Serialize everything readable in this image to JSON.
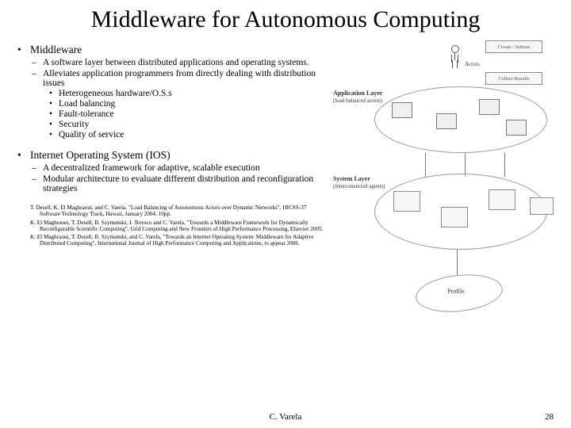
{
  "title": "Middleware for Autonomous Computing",
  "section1": {
    "heading": "Middleware",
    "items": [
      "A software layer between distributed applications and operating systems.",
      "Alleviates application programmers from directly dealing with distribution issues"
    ],
    "subitems": [
      "Heterogeneous hardware/O.S.s",
      "Load balancing",
      "Fault-tolerance",
      "Security",
      "Quality of service"
    ]
  },
  "section2": {
    "heading": "Internet Operating System (IOS)",
    "items": [
      "A decentralized framework for adaptive, scalable execution",
      "Modular architecture to evaluate different distribution and reconfiguration strategies"
    ]
  },
  "references": [
    "T. Desell, K. El Maghraoui, and C. Varela, \"Load Balancing of Autonomous Actors over Dynamic Networks\", HICSS-37 Software Technology Track, Hawaii, January 2004. 10pp.",
    "K. El Maghraoui, T. Desell, B. Szymanski, J. Teresco and C. Varela, \"Towards a Middleware Framework for Dynamically Reconfigurable Scientific Computing\", Grid Computing and New Frontiers of High Performance Processing, Elsevier 2005.",
    "K. El Maghraoui, T. Desell, B. Szymanski, and C. Varela, \"Towards an Internet Operating System: Middleware for Adaptive Distributed Computing\", International Journal of High Performance Computing and Applications, to appear 2006."
  ],
  "diagram": {
    "topbox": "Create / Initiate",
    "actors_label": "Actors",
    "resultsbox": "Collect Results",
    "layer_app": "Application Layer",
    "layer_app_sub": "(load balanced actors)",
    "layer_sys": "System Layer",
    "layer_sys_sub": "(interconnected agents)",
    "profile": "Profile"
  },
  "footer": {
    "author": "C. Varela",
    "page": "28"
  }
}
